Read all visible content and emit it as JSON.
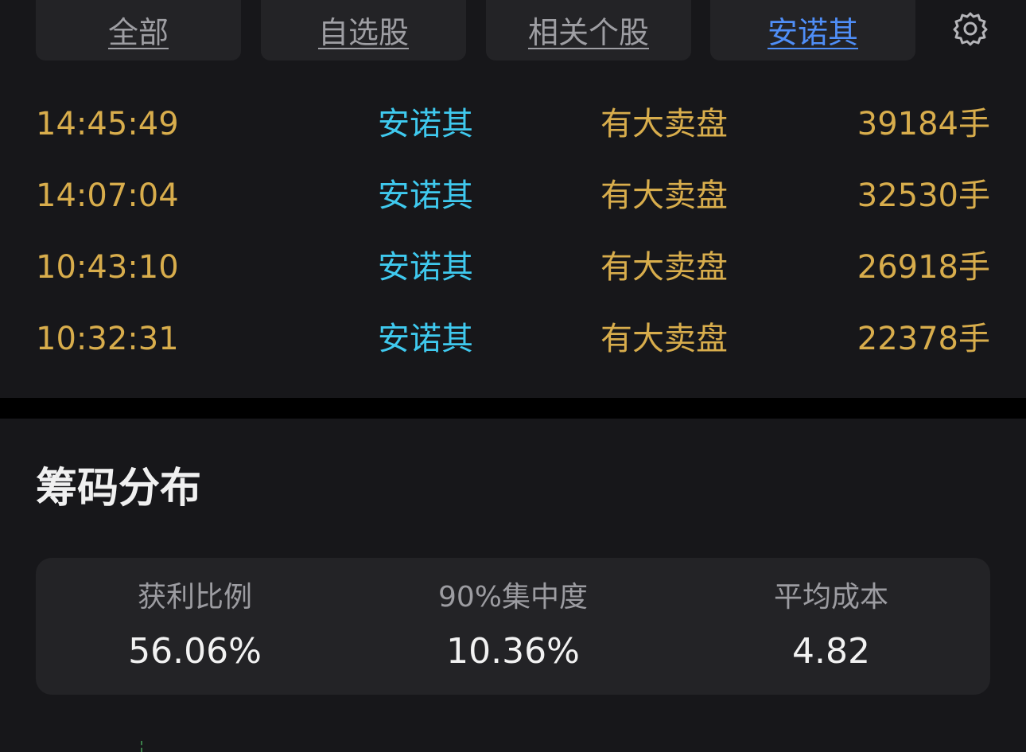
{
  "tabs": [
    {
      "label": "全部",
      "active": false
    },
    {
      "label": "自选股",
      "active": false
    },
    {
      "label": "相关个股",
      "active": false
    },
    {
      "label": "安诺其",
      "active": true
    }
  ],
  "settings_icon": "gear-icon",
  "trades": [
    {
      "time": "14:45:49",
      "stock": "安诺其",
      "type": "有大卖盘",
      "volume": "39184手"
    },
    {
      "time": "14:07:04",
      "stock": "安诺其",
      "type": "有大卖盘",
      "volume": "32530手"
    },
    {
      "time": "10:43:10",
      "stock": "安诺其",
      "type": "有大卖盘",
      "volume": "26918手"
    },
    {
      "time": "10:32:31",
      "stock": "安诺其",
      "type": "有大卖盘",
      "volume": "22378手"
    }
  ],
  "chip_distribution": {
    "title": "筹码分布",
    "stats": [
      {
        "label": "获利比例",
        "value": "56.06%"
      },
      {
        "label": "90%集中度",
        "value": "10.36%"
      },
      {
        "label": "平均成本",
        "value": "4.82"
      }
    ]
  },
  "colors": {
    "background": "#17171a",
    "card": "#232326",
    "time_text": "#d8ad4c",
    "stock_text": "#3fc9ee",
    "active_tab": "#4f8ef7"
  }
}
